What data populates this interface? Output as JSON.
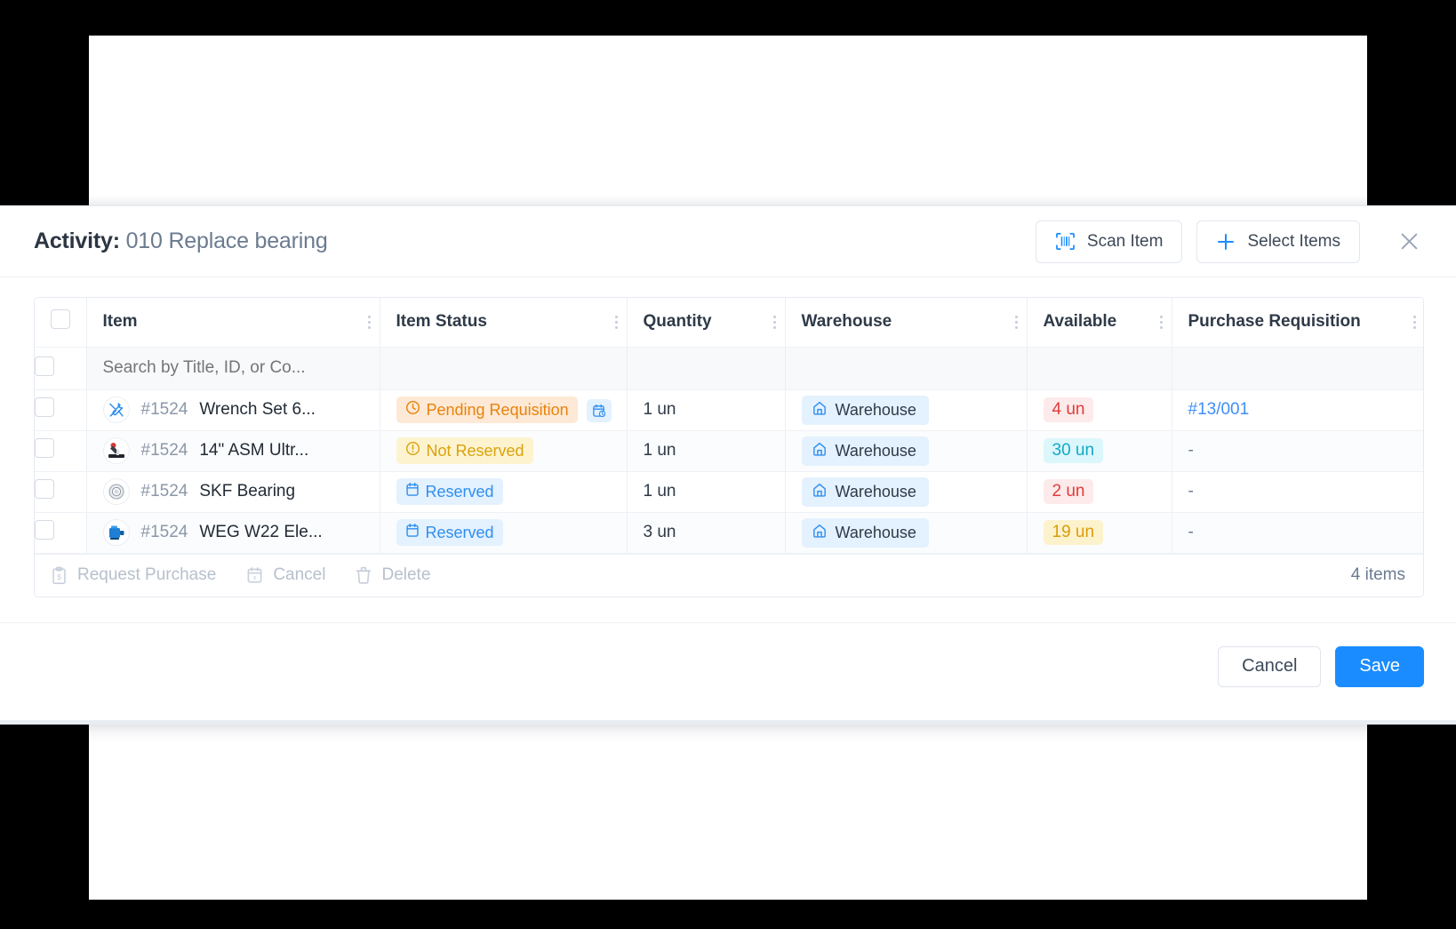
{
  "modal": {
    "title_prefix": "Activity:",
    "title_value": "010 Replace bearing",
    "scan_item_label": "Scan Item",
    "select_items_label": "Select Items",
    "close_label": "×"
  },
  "table": {
    "columns": [
      "Item",
      "Item Status",
      "Quantity",
      "Warehouse",
      "Available",
      "Purchase Requisition"
    ],
    "search_placeholder": "Search by Title, ID, or Co...",
    "search_value": "",
    "rows": [
      {
        "item_id": "#1524",
        "item_name": "Wrench Set 6...",
        "thumb": "tools-icon",
        "status": "Pending Requisition",
        "status_tone": "orange",
        "status_icon": "clock-icon",
        "has_schedule_button": true,
        "quantity": "1 un",
        "warehouse": "Warehouse",
        "available": "4 un",
        "available_tone": "red",
        "purchase_requisition": "#13/001",
        "purchase_requisition_is_link": true
      },
      {
        "item_id": "#1524",
        "item_name": "14\" ASM Ultr...",
        "thumb": "clamp-icon",
        "status": "Not Reserved",
        "status_tone": "yellow",
        "status_icon": "alert-circle-icon",
        "has_schedule_button": false,
        "quantity": "1 un",
        "warehouse": "Warehouse",
        "available": "30 un",
        "available_tone": "cyan",
        "purchase_requisition": "-",
        "purchase_requisition_is_link": false
      },
      {
        "item_id": "#1524",
        "item_name": "SKF Bearing",
        "thumb": "bearing-icon",
        "status": "Reserved",
        "status_tone": "blue",
        "status_icon": "calendar-icon",
        "has_schedule_button": false,
        "quantity": "1 un",
        "warehouse": "Warehouse",
        "available": "2 un",
        "available_tone": "red",
        "purchase_requisition": "-",
        "purchase_requisition_is_link": false
      },
      {
        "item_id": "#1524",
        "item_name": "WEG W22 Ele...",
        "thumb": "motor-icon",
        "status": "Reserved",
        "status_tone": "blue",
        "status_icon": "calendar-icon",
        "has_schedule_button": false,
        "quantity": "3 un",
        "warehouse": "Warehouse",
        "available": "19 un",
        "available_tone": "yellow",
        "purchase_requisition": "-",
        "purchase_requisition_is_link": false
      }
    ],
    "footer": {
      "request_purchase_label": "Request Purchase",
      "cancel_label": "Cancel",
      "delete_label": "Delete",
      "items_count": "4 items"
    }
  },
  "footer": {
    "cancel_label": "Cancel",
    "save_label": "Save"
  },
  "colors": {
    "primary": "#1a8cff",
    "link": "#3e8ef7",
    "status_orange": "#e8820c",
    "status_yellow": "#daa20b",
    "status_blue": "#2e8ff0",
    "available_red": "#e23b3b",
    "available_cyan": "#13a8c6",
    "available_yellow": "#dd9b09"
  }
}
